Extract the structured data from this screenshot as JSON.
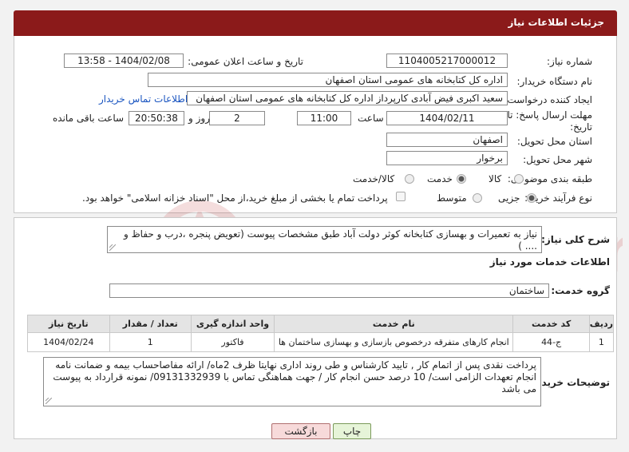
{
  "header": {
    "title": "جزئیات اطلاعات نیاز"
  },
  "form": {
    "need_number_label": "شماره نیاز:",
    "need_number": "1104005217000012",
    "announce_datetime_label": "تاریخ و ساعت اعلان عمومی:",
    "announce_datetime": "1404/02/08 - 13:58",
    "buyer_org_label": "نام دستگاه خریدار:",
    "buyer_org": "اداره کل کتابخانه های عمومی استان اصفهان",
    "requester_label": "ایجاد کننده درخواست:",
    "requester": "سعید اکبری فیض آبادی کارپرداز اداره کل کتابخانه های عمومی استان اصفهان",
    "buyer_contact_link": "اطلاعات تماس خریدار",
    "deadline_label_1": "مهلت ارسال پاسخ: تا",
    "deadline_label_2": "تاریخ:",
    "deadline_date": "1404/02/11",
    "time_label": "ساعت",
    "deadline_time": "11:00",
    "days_value": "2",
    "days_label": "روز و",
    "remaining_time": "20:50:38",
    "remaining_label": "ساعت باقی مانده",
    "province_label": "استان محل تحویل:",
    "province": "اصفهان",
    "city_label": "شهر محل تحویل:",
    "city": "برخوار",
    "category_label": "طبقه بندی موضوعی:",
    "category_options": [
      "کالا",
      "خدمت",
      "کالا/خدمت"
    ],
    "category_selected": "خدمت",
    "process_label": "نوع فرآیند خرید :",
    "process_options": [
      "جزیی",
      "متوسط"
    ],
    "process_selected": "جزیی",
    "treasury_text": "پرداخت تمام یا بخشی از مبلغ خرید،از محل \"اسناد خزانه اسلامی\" خواهد بود."
  },
  "description": {
    "label": "شرح کلی نیاز:",
    "text": "نیاز به تعمیرات و بهسازی کتابخانه کوثر دولت آباد طبق مشخصات پیوست (تعویض پنجره ،درب و حفاظ و .... )"
  },
  "services": {
    "section_title": "اطلاعات خدمات مورد نیاز",
    "group_label": "گروه خدمت:",
    "group_value": "ساختمان",
    "columns": [
      "ردیف",
      "کد خدمت",
      "نام خدمت",
      "واحد اندازه گیری",
      "تعداد / مقدار",
      "تاریخ نیاز"
    ],
    "rows": [
      [
        "1",
        "ج-44",
        "انجام کارهای متفرقه درخصوص بازسازی و بهسازی ساختمان ها",
        "فاکتور",
        "1",
        "1404/02/24"
      ]
    ]
  },
  "buyer_notes": {
    "label": "توضیحات خریدار:",
    "text": "پرداخت نقدی پس از اتمام کار , تایید کارشناس و طی روند اداری نهایتا ظرف 2ماه/ ارائه مفاصاحساب بیمه و ضمانت نامه انجام تعهدات الزامی است/ 10 درصد حسن انجام کار / جهت هماهنگی تماس با 09131332939/ نمونه قرارداد به پیوست می باشد"
  },
  "buttons": {
    "print": "چاپ",
    "back": "بازگشت"
  },
  "watermark": {
    "text": "AriaTender.neT"
  }
}
